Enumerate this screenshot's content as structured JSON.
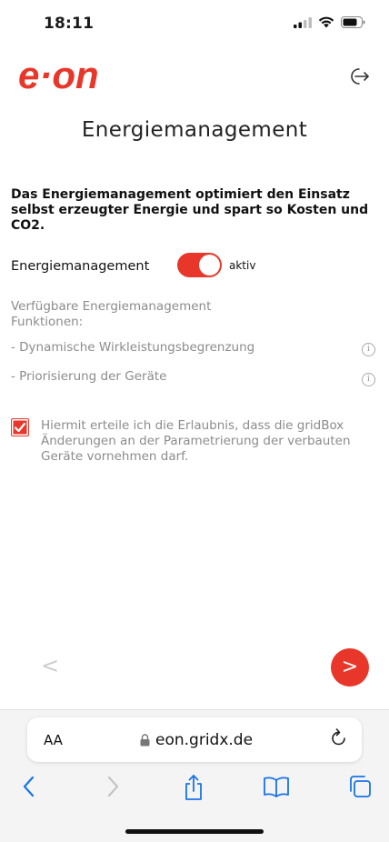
{
  "status_bar": {
    "time": "18:11"
  },
  "brand": {
    "logo_text": "e·on",
    "accent_color": "#e8372a"
  },
  "header": {
    "logout_icon": "logout-icon"
  },
  "page": {
    "title": "Energiemanagement",
    "intro": "Das Energiemanagement optimiert den Einsatz selbst erzeugter Energie und spart so Kosten und CO2.",
    "toggle": {
      "label": "Energiemanagement",
      "state_label": "aktiv",
      "on": true
    },
    "functions_title": "Verfügbare Energiemanagement Funktionen:",
    "features": [
      {
        "label": "- Dynamische Wirkleistungsbegrenzung",
        "info": "i"
      },
      {
        "label": "- Priorisierung der Geräte",
        "info": "i"
      }
    ],
    "consent": {
      "checked": true,
      "text": "Hiermit erteile ich die Erlaubnis, dass die gridBox Änderungen an der Parametrierung der verbauten Geräte vornehmen darf."
    },
    "nav": {
      "prev": "<",
      "next": ">"
    }
  },
  "browser": {
    "text_size_label": "AA",
    "url": "eon.gridx.de",
    "toolbar_icons": [
      "back-icon",
      "forward-icon",
      "share-icon",
      "bookmarks-icon",
      "tabs-icon"
    ]
  }
}
